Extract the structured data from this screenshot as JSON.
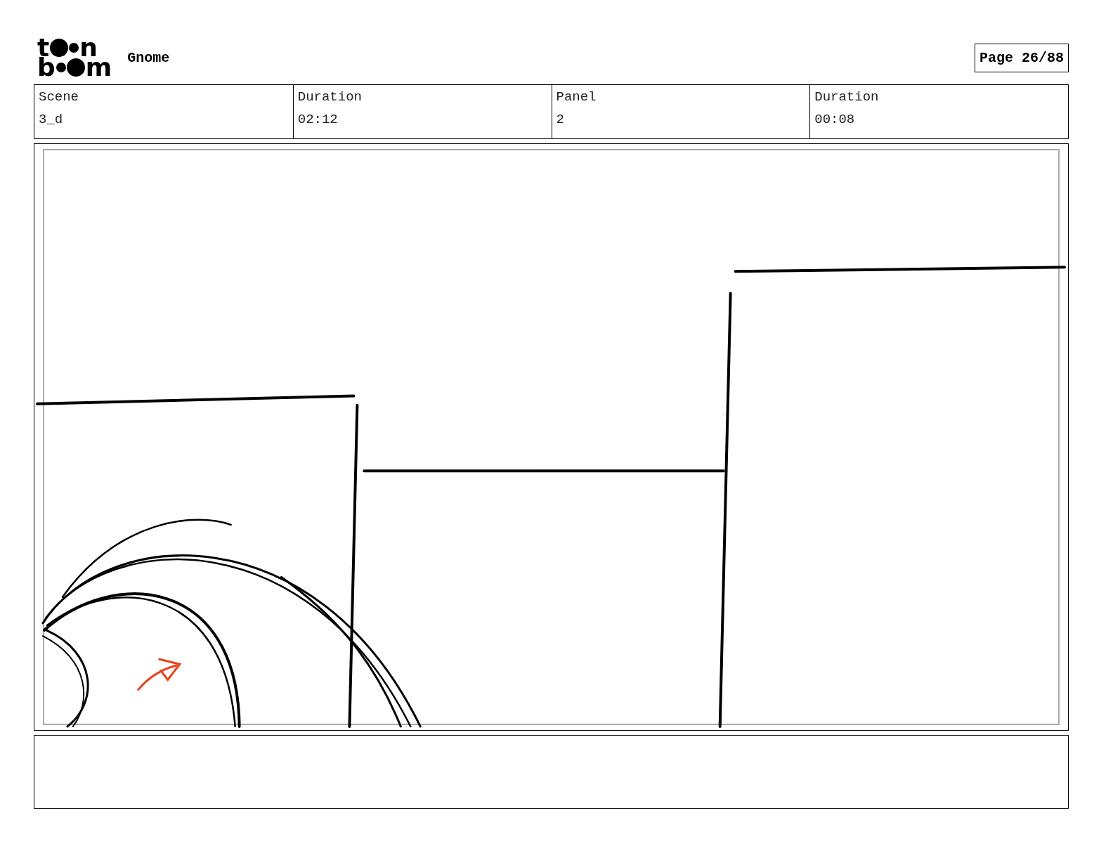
{
  "header": {
    "logo": {
      "lines": [
        [
          "t",
          "n"
        ],
        [
          "b",
          "m"
        ]
      ]
    },
    "title": "Gnome",
    "page": "Page 26/88"
  },
  "info": [
    {
      "label": "Scene",
      "value": "3_d"
    },
    {
      "label": "Duration",
      "value": "02:12"
    },
    {
      "label": "Panel",
      "value": "2"
    },
    {
      "label": "Duration",
      "value": "00:08"
    }
  ],
  "panel": {
    "kind": "sketch"
  }
}
